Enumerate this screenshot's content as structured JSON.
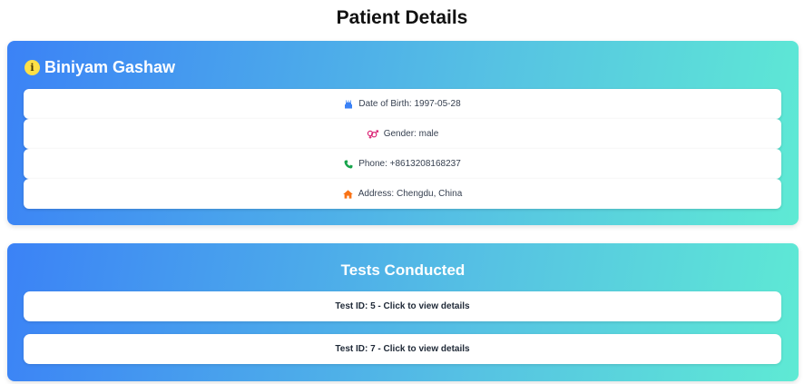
{
  "page": {
    "title": "Patient Details"
  },
  "patient": {
    "name": "Biniyam Gashaw",
    "name_icon": "info-icon",
    "details": [
      {
        "icon": "birthday-cake-icon",
        "text": "Date of Birth: 1997-05-28",
        "icon_color": "#3b82f6"
      },
      {
        "icon": "gender-icon",
        "text": "Gender: male",
        "icon_color": "#db2777"
      },
      {
        "icon": "phone-icon",
        "text": "Phone: +8613208168237",
        "icon_color": "#16a34a"
      },
      {
        "icon": "home-icon",
        "text": "Address: Chengdu, China",
        "icon_color": "#f97316"
      }
    ]
  },
  "tests": {
    "heading": "Tests Conducted",
    "items": [
      {
        "label": "Test ID: 5 - Click to view details"
      },
      {
        "label": "Test ID: 7 - Click to view details"
      }
    ]
  },
  "colors": {
    "gradient_start": "#3b82f6",
    "gradient_end": "#5eead4",
    "info_icon": "#fde047"
  }
}
